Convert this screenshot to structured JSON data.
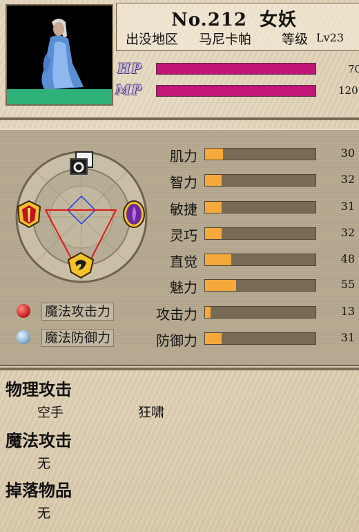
{
  "monster": {
    "number_label": "No.212",
    "name": "女妖",
    "location_label": "出没地区",
    "location": "马尼卡帕",
    "level_label": "等级",
    "level": "Lv23"
  },
  "resources": [
    {
      "label": "HP",
      "value": "70",
      "fill": 1.0
    },
    {
      "label": "MP",
      "value": "120",
      "fill": 1.0
    }
  ],
  "stats": [
    {
      "label": "肌力",
      "value": "30",
      "fill": 0.16
    },
    {
      "label": "智力",
      "value": "32",
      "fill": 0.15
    },
    {
      "label": "敏捷",
      "value": "31",
      "fill": 0.15
    },
    {
      "label": "灵巧",
      "value": "32",
      "fill": 0.15
    },
    {
      "label": "直觉",
      "value": "48",
      "fill": 0.24
    },
    {
      "label": "魅力",
      "value": "55",
      "fill": 0.28
    },
    {
      "label": "攻击力",
      "value": "13",
      "fill": 0.05
    },
    {
      "label": "防御力",
      "value": "31",
      "fill": 0.15
    }
  ],
  "magic": {
    "attack_label": "魔法攻击力",
    "defense_label": "魔法防御力"
  },
  "sections": {
    "physical_title": "物理攻击",
    "physical_items": [
      "空手",
      "狂啸"
    ],
    "magic_title": "魔法攻击",
    "magic_items": [
      "无"
    ],
    "drop_title": "掉落物品",
    "drop_items": [
      "无"
    ]
  },
  "colors": {
    "hp_mp_bar": "#c2157a",
    "stat_fill": "#f4a93a",
    "attack_orb": "#d42a2a",
    "defense_orb": "#8fb7d8"
  }
}
